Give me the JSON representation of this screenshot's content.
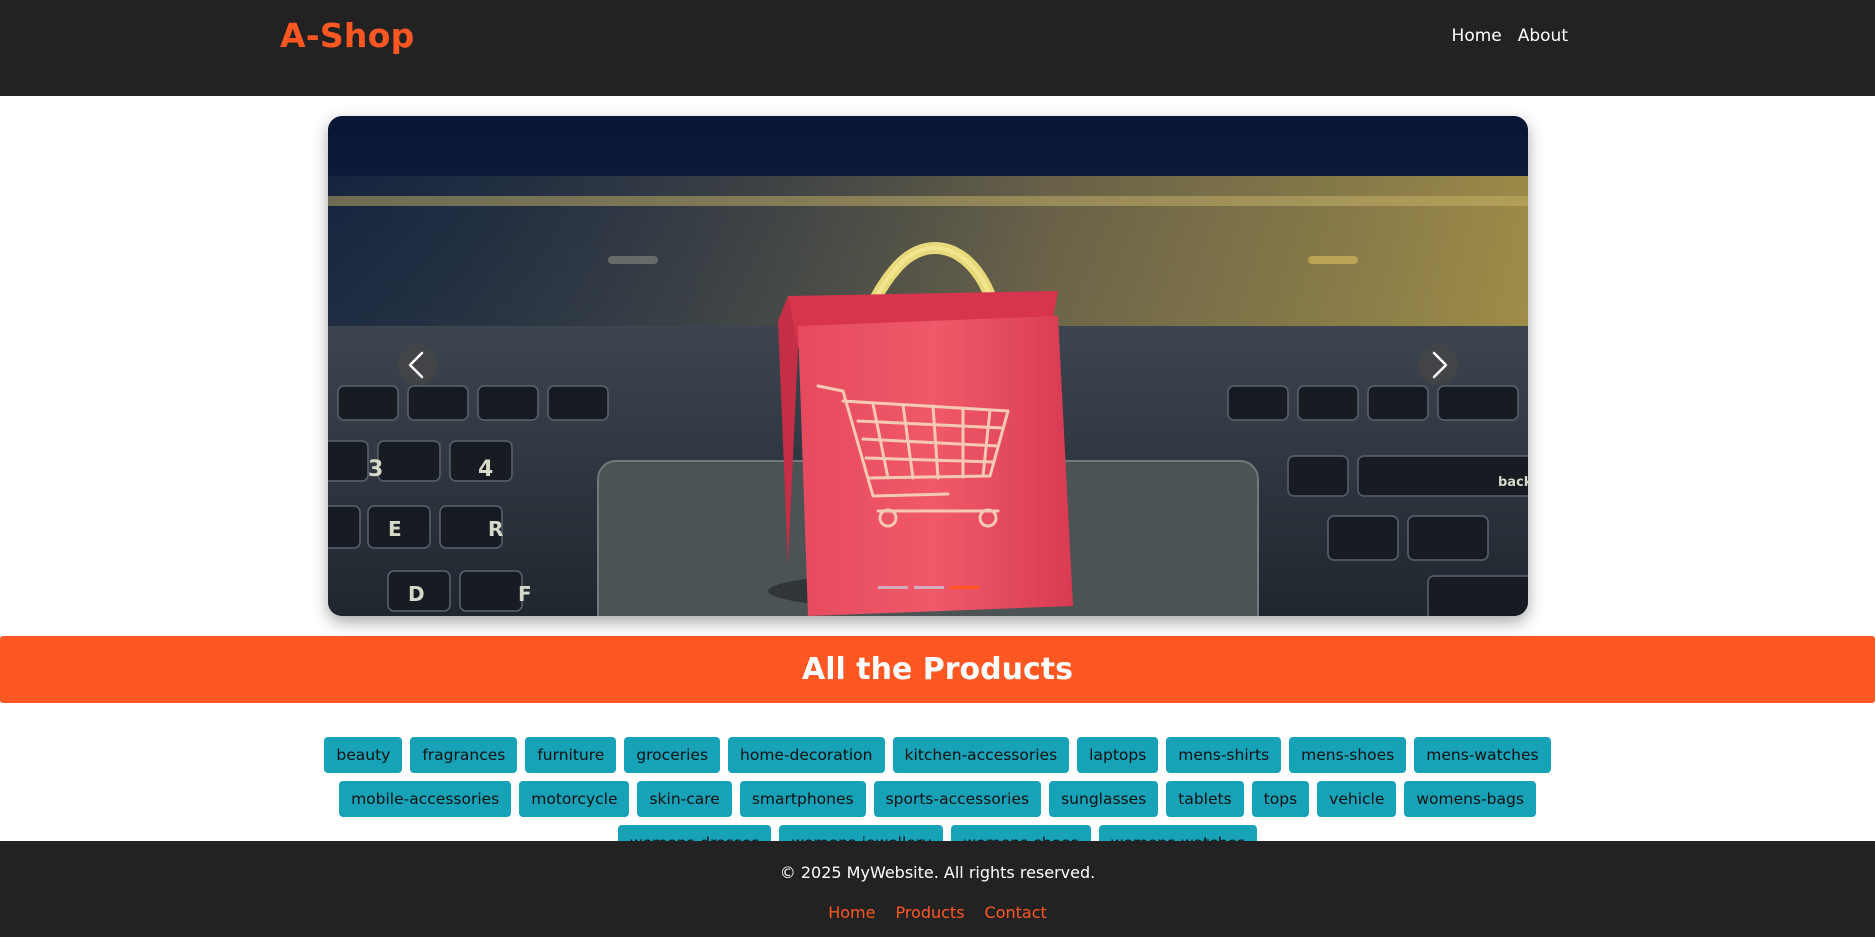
{
  "header": {
    "brand": "A-Shop",
    "nav": [
      {
        "label": "Home"
      },
      {
        "label": "About"
      }
    ]
  },
  "carousel": {
    "slide_image": "shopping-bag-cart-on-laptop",
    "prev_icon": "chevron-left-icon",
    "next_icon": "chevron-right-icon",
    "slide_count": 3,
    "active_slide": 3
  },
  "banner": {
    "title": "All the Products"
  },
  "categories": [
    "beauty",
    "fragrances",
    "furniture",
    "groceries",
    "home-decoration",
    "kitchen-accessories",
    "laptops",
    "mens-shirts",
    "mens-shoes",
    "mens-watches",
    "mobile-accessories",
    "motorcycle",
    "skin-care",
    "smartphones",
    "sports-accessories",
    "sunglasses",
    "tablets",
    "tops",
    "vehicle",
    "womens-bags",
    "womens-dresses",
    "womens-jewellery",
    "womens-shoes",
    "womens-watches"
  ],
  "footer": {
    "copyright": "© 2025 MyWebsite. All rights reserved.",
    "links": [
      {
        "label": "Home"
      },
      {
        "label": "Products"
      },
      {
        "label": "Contact"
      }
    ]
  },
  "colors": {
    "accent": "#ff5722",
    "dark": "#222222",
    "category_bg": "#17a2b8"
  }
}
